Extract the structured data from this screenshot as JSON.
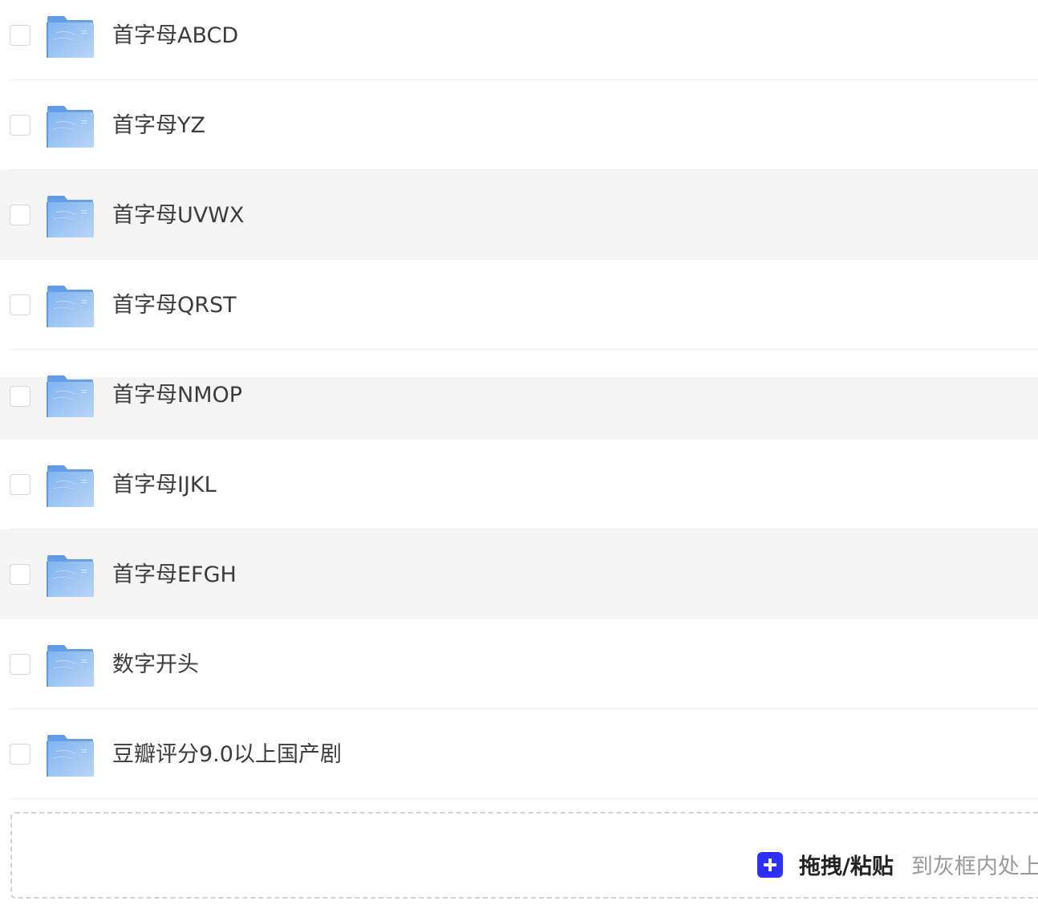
{
  "file_list": {
    "items": [
      {
        "name": "首字母ABCD",
        "icon": "folder-icon"
      },
      {
        "name": "首字母YZ",
        "icon": "folder-icon"
      },
      {
        "name": "首字母UVWX",
        "icon": "folder-icon"
      },
      {
        "name": "首字母QRST",
        "icon": "folder-icon"
      },
      {
        "name": "首字母NMOP",
        "icon": "folder-icon"
      },
      {
        "name": "首字母IJKL",
        "icon": "folder-icon"
      },
      {
        "name": "首字母EFGH",
        "icon": "folder-icon"
      },
      {
        "name": "数字开头",
        "icon": "folder-icon"
      },
      {
        "name": "豆瓣评分9.0以上国产剧",
        "icon": "folder-icon"
      }
    ]
  },
  "upload": {
    "icon": "plus-icon",
    "action_label": "拖拽/粘贴",
    "hint": "到灰框内处上"
  },
  "colors": {
    "accent": "#2f2ffc",
    "row_highlight": "#f5f5f5",
    "folder": "#8cbaf0",
    "text": "#3c3c3c"
  }
}
